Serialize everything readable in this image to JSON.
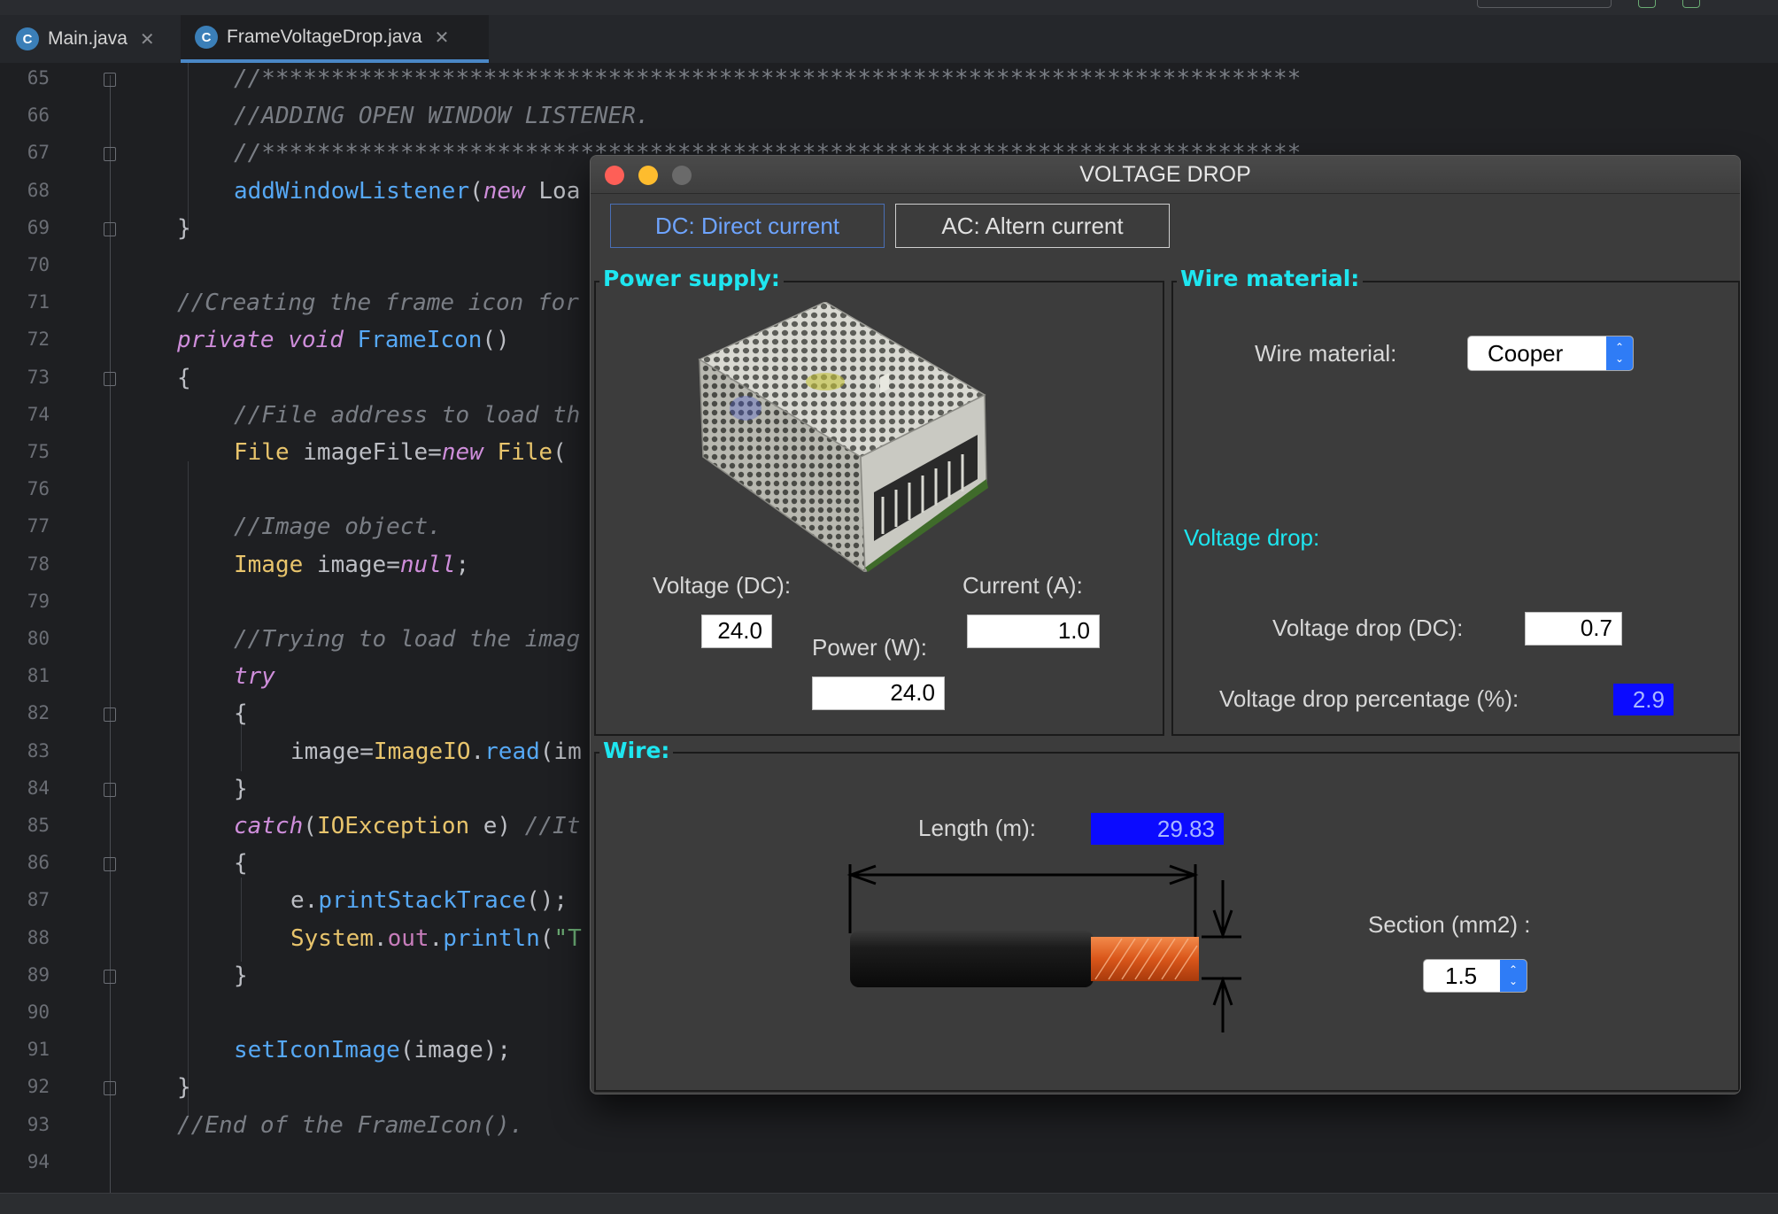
{
  "ide": {
    "tabs": [
      {
        "label": "Main.java",
        "icon": "class-icon",
        "active": false
      },
      {
        "label": "FrameVoltageDrop.java",
        "icon": "class-icon",
        "active": true
      }
    ],
    "line_numbers": [
      "65",
      "66",
      "67",
      "68",
      "69",
      "70",
      "71",
      "72",
      "73",
      "74",
      "75",
      "76",
      "77",
      "78",
      "79",
      "80",
      "81",
      "82",
      "83",
      "84",
      "85",
      "86",
      "87",
      "88",
      "89",
      "90",
      "91",
      "92",
      "93",
      "94"
    ],
    "code_lines": [
      "//***************************************************************************",
      "//ADDING OPEN WINDOW LISTENER.",
      "//***************************************************************************",
      "addWindowListener(new Loa",
      "}",
      "",
      "//Creating the frame icon for",
      "private void FrameIcon()",
      "{",
      "//File address to load th",
      "File imageFile=new File(",
      "",
      "//Image object.",
      "Image image=null;",
      "",
      "//Trying to load the imag",
      "try",
      "{",
      "image=ImageIO.read(im",
      "}",
      "catch(IOException e) //It",
      "{",
      "e.printStackTrace();",
      "System.out.println(\"T",
      "}",
      "",
      "setIconImage(image);",
      "}",
      "//End of the FrameIcon().",
      ""
    ]
  },
  "window": {
    "title": "VOLTAGE DROP",
    "tabs": {
      "dc": "DC: Direct current",
      "ac": "AC: Altern current"
    },
    "power_supply": {
      "title": "Power supply:",
      "voltage_label": "Voltage (DC):",
      "voltage_value": "24.0",
      "current_label": "Current (A):",
      "current_value": "1.0",
      "power_label": "Power (W):",
      "power_value": "24.0"
    },
    "wire_material": {
      "title": "Wire material:",
      "label": "Wire material:",
      "selected": "Cooper",
      "voltage_drop_heading": "Voltage drop:",
      "vdrop_label": "Voltage drop (DC):",
      "vdrop_value": "0.7",
      "vdrop_pct_label": "Voltage drop percentage (%):",
      "vdrop_pct_value": "2.9"
    },
    "wire": {
      "title": "Wire:",
      "length_label": "Length (m):",
      "length_value": "29.83",
      "section_label": "Section (mm2) :",
      "section_selected": "1.5"
    },
    "colors": {
      "accent_cyan": "#1ee6f0",
      "highlight_blue": "#0b0bff",
      "combo_blue": "#2f7cf6",
      "copper": "#e8641e"
    }
  }
}
